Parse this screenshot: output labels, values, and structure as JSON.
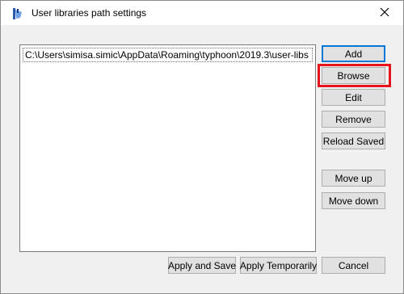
{
  "window": {
    "title": "User libraries path settings",
    "app_icon": "typhoon-app-icon",
    "close_glyph": "✕"
  },
  "paths": {
    "items": [
      "C:\\Users\\simisa.simic\\AppData\\Roaming\\typhoon\\2019.3\\user-libs"
    ]
  },
  "side_buttons": {
    "add": "Add",
    "browse": "Browse",
    "edit": "Edit",
    "remove": "Remove",
    "reload_saved": "Reload Saved",
    "move_up": "Move up",
    "move_down": "Move down"
  },
  "bottom_buttons": {
    "apply_and_save": "Apply and Save",
    "apply_temporarily": "Apply Temporarily",
    "cancel": "Cancel"
  },
  "colors": {
    "highlight": "#e8141b",
    "focus_border": "#0078d7"
  }
}
